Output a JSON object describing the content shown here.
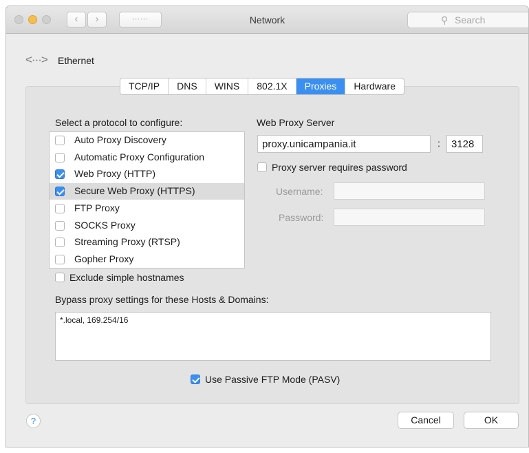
{
  "window": {
    "title": "Network",
    "search_placeholder": "Search"
  },
  "breadcrumb": {
    "icon": "ethernet-icon",
    "icon_glyph": "<···>",
    "label": "Ethernet"
  },
  "tabs": [
    {
      "label": "TCP/IP",
      "active": false
    },
    {
      "label": "DNS",
      "active": false
    },
    {
      "label": "WINS",
      "active": false
    },
    {
      "label": "802.1X",
      "active": false
    },
    {
      "label": "Proxies",
      "active": true
    },
    {
      "label": "Hardware",
      "active": false
    }
  ],
  "protocols": {
    "heading": "Select a protocol to configure:",
    "items": [
      {
        "label": "Auto Proxy Discovery",
        "checked": false,
        "selected": false
      },
      {
        "label": "Automatic Proxy Configuration",
        "checked": false,
        "selected": false
      },
      {
        "label": "Web Proxy (HTTP)",
        "checked": true,
        "selected": false
      },
      {
        "label": "Secure Web Proxy (HTTPS)",
        "checked": true,
        "selected": true
      },
      {
        "label": "FTP Proxy",
        "checked": false,
        "selected": false
      },
      {
        "label": "SOCKS Proxy",
        "checked": false,
        "selected": false
      },
      {
        "label": "Streaming Proxy (RTSP)",
        "checked": false,
        "selected": false
      },
      {
        "label": "Gopher Proxy",
        "checked": false,
        "selected": false
      }
    ]
  },
  "exclude_simple": {
    "label": "Exclude simple hostnames",
    "checked": false
  },
  "proxy_server": {
    "heading": "Web Proxy Server",
    "host": "proxy.unicampania.it",
    "separator": ":",
    "port": "3128",
    "requires_password": {
      "label": "Proxy server requires password",
      "checked": false
    },
    "username_label": "Username:",
    "username_value": "",
    "password_label": "Password:",
    "password_value": ""
  },
  "bypass": {
    "heading": "Bypass proxy settings for these Hosts & Domains:",
    "value": "*.local, 169.254/16"
  },
  "passive_ftp": {
    "label": "Use Passive FTP Mode (PASV)",
    "checked": true
  },
  "footer": {
    "help_glyph": "?",
    "cancel_label": "Cancel",
    "ok_label": "OK"
  },
  "colors": {
    "accent": "#3b8ff1",
    "selected_row": "#dcdcdc"
  }
}
